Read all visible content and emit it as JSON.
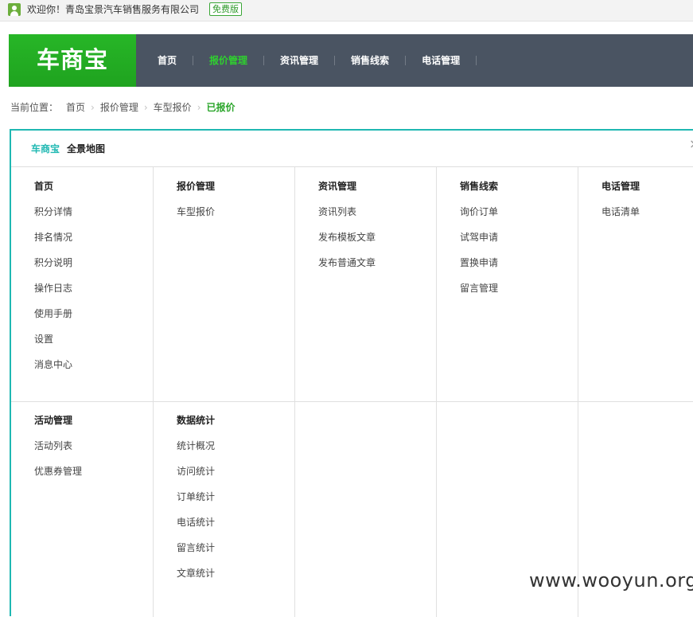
{
  "topbar": {
    "welcome": "欢迎你！青岛宝景汽车销售服务有限公司",
    "badge": "免费版"
  },
  "header": {
    "logo": "车商宝",
    "nav": [
      "首页",
      "报价管理",
      "资讯管理",
      "销售线索",
      "电话管理"
    ],
    "active_nav": "报价管理"
  },
  "breadcrumb": {
    "label": "当前位置：",
    "items": [
      "首页",
      "报价管理",
      "车型报价",
      "已报价"
    ]
  },
  "sitemap": {
    "brand": "车商宝",
    "title": "全景地图",
    "close": "×",
    "row1": [
      {
        "title": "首页",
        "links": [
          "积分详情",
          "排名情况",
          "积分说明",
          "操作日志",
          "使用手册",
          "设置",
          "消息中心"
        ]
      },
      {
        "title": "报价管理",
        "links": [
          "车型报价"
        ]
      },
      {
        "title": "资讯管理",
        "links": [
          "资讯列表",
          "发布模板文章",
          "发布普通文章"
        ]
      },
      {
        "title": "销售线索",
        "links": [
          "询价订单",
          "试驾申请",
          "置换申请",
          "留言管理"
        ]
      },
      {
        "title": "电话管理",
        "links": [
          "电话清单"
        ]
      }
    ],
    "row2": [
      {
        "title": "活动管理",
        "links": [
          "活动列表",
          "优惠券管理"
        ]
      },
      {
        "title": "数据统计",
        "links": [
          "统计概况",
          "访问统计",
          "订单统计",
          "电话统计",
          "留言统计",
          "文章统计"
        ]
      }
    ]
  },
  "watermark": "www.wooyun.org",
  "colors": {
    "brand_green": "#22ac22",
    "header_bg": "#4a5462",
    "panel_accent": "#1fb8b2",
    "active_nav": "#2fd02f"
  }
}
